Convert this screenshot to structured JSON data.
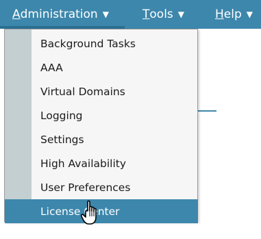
{
  "menubar": {
    "items": [
      {
        "mnemonic": "A",
        "rest": "dministration",
        "caret": "▼"
      },
      {
        "mnemonic": "T",
        "rest": "ools",
        "caret": "▼"
      },
      {
        "mnemonic": "H",
        "rest": "elp",
        "caret": "▼"
      }
    ]
  },
  "dropdown": {
    "items": [
      {
        "label": "Background Tasks"
      },
      {
        "label": "AAA"
      },
      {
        "label": "Virtual Domains"
      },
      {
        "label": "Logging"
      },
      {
        "label": "Settings"
      },
      {
        "label": "High Availability"
      },
      {
        "label": "User Preferences"
      },
      {
        "label": "License Center",
        "highlighted": true
      }
    ]
  },
  "colors": {
    "menubar": "#3d87ac",
    "dropdown_bg": "#f6f6f6",
    "gutter": "#c3cfd1",
    "highlight": "#3d87ac"
  },
  "icons": {
    "cursor": "hand-pointer-icon",
    "caret": "caret-down-icon"
  }
}
